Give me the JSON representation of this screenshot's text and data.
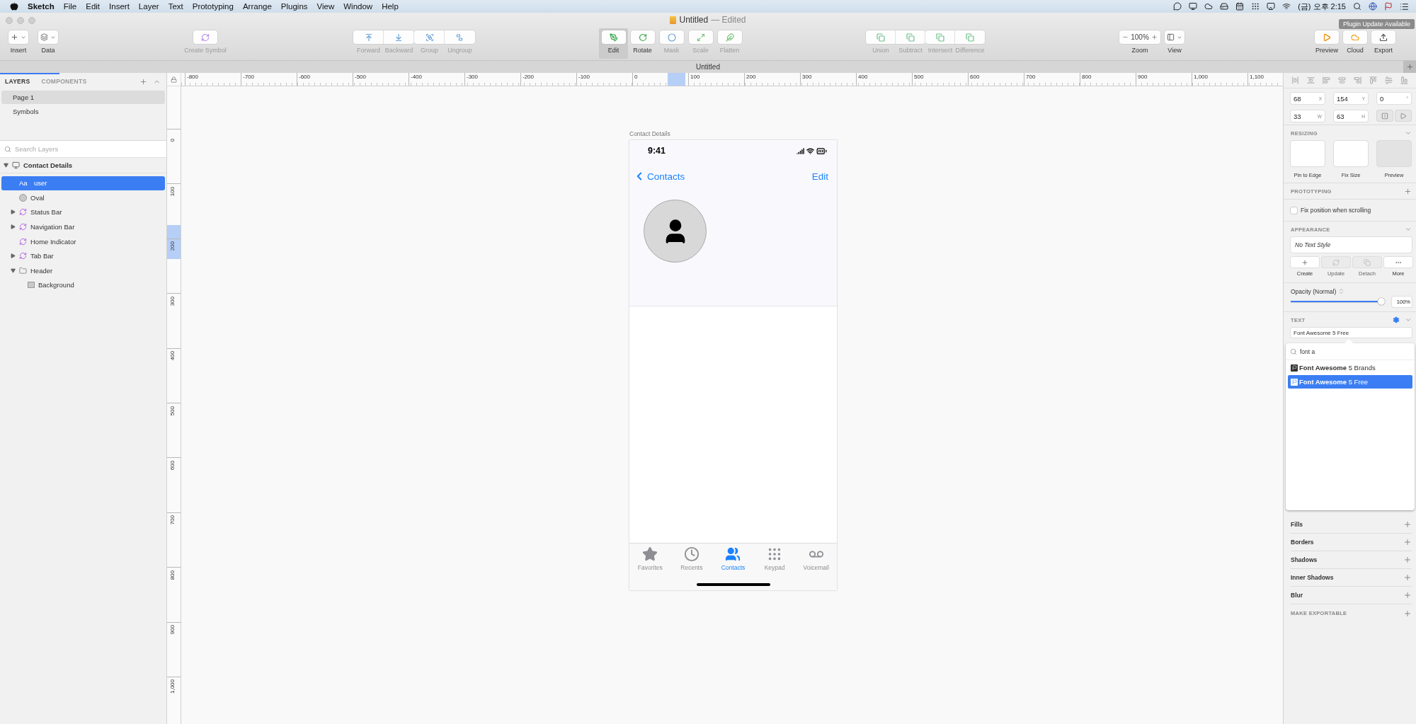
{
  "menu_bar": {
    "app": "Sketch",
    "menus": [
      "File",
      "Edit",
      "Insert",
      "Layer",
      "Text",
      "Prototyping",
      "Arrange",
      "Plugins",
      "View",
      "Window",
      "Help"
    ],
    "clock": "(금) 오후 2:15"
  },
  "window": {
    "title": "Untitled",
    "status": "— Edited",
    "notice": "Plugin Update Available"
  },
  "toolbar": {
    "groups": [
      [
        {
          "kind": "dropdown",
          "label": "Insert",
          "disabled": false,
          "selected": false
        },
        {
          "kind": "dropdown",
          "label": "Data",
          "disabled": false,
          "selected": false
        }
      ],
      [
        {
          "kind": "button",
          "label": "Create Symbol",
          "disabled": true,
          "selected": false
        }
      ],
      [
        {
          "kind": "segment",
          "label": "Forward",
          "disabled": true,
          "selected": false
        },
        {
          "kind": "segment",
          "label": "Backward",
          "disabled": true,
          "selected": false
        },
        {
          "kind": "segment",
          "label": "Group",
          "disabled": true,
          "selected": false
        },
        {
          "kind": "segment",
          "label": "Ungroup",
          "disabled": true,
          "selected": false
        }
      ],
      [
        {
          "kind": "button",
          "label": "Edit",
          "disabled": false,
          "selected": true
        },
        {
          "kind": "button",
          "label": "Rotate",
          "disabled": false,
          "selected": false
        },
        {
          "kind": "button",
          "label": "Mask",
          "disabled": true,
          "selected": false
        },
        {
          "kind": "button",
          "label": "Scale",
          "disabled": true,
          "selected": false
        },
        {
          "kind": "button",
          "label": "Flatten",
          "disabled": true,
          "selected": false
        }
      ],
      [
        {
          "kind": "segment",
          "label": "Union",
          "disabled": true,
          "selected": false
        },
        {
          "kind": "segment",
          "label": "Subtract",
          "disabled": true,
          "selected": false
        },
        {
          "kind": "segment",
          "label": "Intersect",
          "disabled": true,
          "selected": false
        },
        {
          "kind": "segment",
          "label": "Difference",
          "disabled": true,
          "selected": false
        }
      ],
      [
        {
          "kind": "zoom",
          "label": "Zoom",
          "value": "100%",
          "disabled": false,
          "selected": false
        },
        {
          "kind": "dropdown",
          "label": "View",
          "disabled": false,
          "selected": false
        }
      ],
      [
        {
          "kind": "button",
          "label": "Preview",
          "disabled": false,
          "selected": false
        },
        {
          "kind": "button",
          "label": "Cloud",
          "disabled": false,
          "selected": false
        },
        {
          "kind": "button",
          "label": "Export",
          "disabled": false,
          "selected": false
        }
      ]
    ]
  },
  "document_tab": "Untitled",
  "layers_panel": {
    "tabs": [
      {
        "label": "LAYERS",
        "selected": true
      },
      {
        "label": "COMPONENTS",
        "selected": false
      }
    ],
    "pages": [
      {
        "name": "Page 1",
        "selected": true
      },
      {
        "name": "Symbols",
        "selected": false
      }
    ],
    "search": {
      "placeholder": "Search Layers"
    },
    "layers": [
      {
        "name": "Contact Details",
        "kind": "artboard",
        "selected": false,
        "expanded": true,
        "children": [
          {
            "name": "user",
            "kind": "text",
            "glyph": "Aa",
            "selected": true
          },
          {
            "name": "Oval",
            "kind": "oval",
            "selected": false
          },
          {
            "name": "Status Bar",
            "kind": "symbol",
            "selected": false,
            "expanded": false
          },
          {
            "name": "Navigation Bar",
            "kind": "symbol",
            "selected": false,
            "expanded": false
          },
          {
            "name": "Home Indicator",
            "kind": "symbol",
            "selected": false
          },
          {
            "name": "Tab Bar",
            "kind": "symbol",
            "selected": false,
            "expanded": false
          },
          {
            "name": "Header",
            "kind": "group",
            "selected": false,
            "expanded": true,
            "children": [
              {
                "name": "Background",
                "kind": "rectangle",
                "selected": false
              }
            ]
          }
        ]
      }
    ]
  },
  "rulers": {
    "horizontal": [
      "-800",
      "-700",
      "-600",
      "-500",
      "-400",
      "-300",
      "-200",
      "-100",
      "0",
      "100",
      "200",
      "300",
      "400",
      "500",
      "600",
      "700",
      "800",
      "900",
      "1,000",
      "1,100"
    ],
    "vertical": [
      "0",
      "100",
      "200",
      "300",
      "400",
      "500",
      "600",
      "700",
      "800",
      "900",
      "1,000"
    ]
  },
  "artboard": {
    "title": "Contact Details",
    "time": "9:41",
    "back": "Contacts",
    "action": "Edit",
    "tabs": [
      {
        "label": "Favorites",
        "selected": false
      },
      {
        "label": "Recents",
        "selected": false
      },
      {
        "label": "Contacts",
        "selected": true
      },
      {
        "label": "Keypad",
        "selected": false
      },
      {
        "label": "Voicemail",
        "selected": false
      }
    ]
  },
  "inspector": {
    "fields": [
      [
        {
          "value": "68",
          "unit": "X"
        },
        {
          "value": "154",
          "unit": "Y"
        },
        {
          "value": "0",
          "unit": "°"
        }
      ],
      [
        {
          "value": "33",
          "unit": "W"
        },
        {
          "value": "63",
          "unit": "H"
        }
      ]
    ],
    "resizing": {
      "title": "RESIZING",
      "tiles": [
        "Pin to Edge",
        "Fix Size",
        "Preview"
      ]
    },
    "prototyping": {
      "title": "PROTOTYPING",
      "fix_position": {
        "label": "Fix position when scrolling",
        "checked": false
      }
    },
    "appearance": {
      "title": "APPEARANCE",
      "text_style": "No Text Style",
      "buttons": [
        {
          "label": "Create",
          "disabled": false
        },
        {
          "label": "Update",
          "disabled": true
        },
        {
          "label": "Detach",
          "disabled": true
        },
        {
          "label": "More",
          "disabled": false
        }
      ],
      "opacity_label": "Opacity (Normal)",
      "opacity": {
        "level": 1,
        "value": "100%"
      }
    },
    "text": {
      "title": "TEXT",
      "font": "Font Awesome 5 Free",
      "picker": {
        "query": "font a",
        "fonts": [
          {
            "name": "**Font Awesome** 5 Brands",
            "selected": false
          },
          {
            "name": "**Font Awesome** 5 Free",
            "selected": true
          }
        ]
      }
    },
    "sections": [
      "Fills",
      "Borders",
      "Shadows",
      "Inner Shadows",
      "Blur"
    ],
    "export": "MAKE EXPORTABLE"
  }
}
